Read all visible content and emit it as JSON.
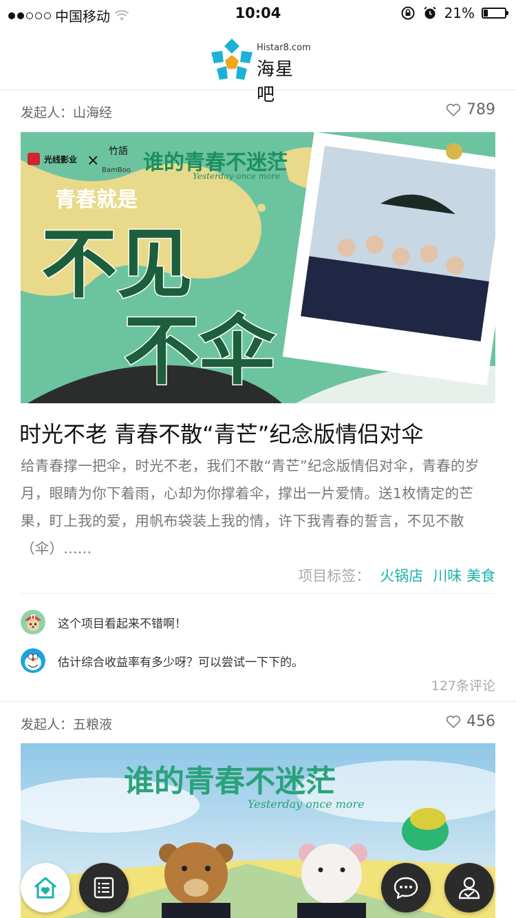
{
  "status_bar": {
    "carrier": "中国移动",
    "time": "10:04",
    "battery": "21%",
    "battery_level": 0.21
  },
  "header": {
    "logo_en": "Histar8.com",
    "logo_zh": "海星吧"
  },
  "cards": [
    {
      "initiator": "发起人：山海经",
      "likes": "789",
      "cover_text": {
        "title_art": "谁的青春不迷茫",
        "sub_art": "Yesterday once more",
        "slogan_small": "青春就是",
        "slogan_big_1": "不见",
        "slogan_big_2": "不伞",
        "brand_1": "光线影业",
        "brand_2": "竹語",
        "brand_2_sub": "BamBoo"
      },
      "title": "时光不老 青春不散“青芒”纪念版情侣对伞",
      "description": "给青春撑一把伞，时光不老，我们不散“青芒”纪念版情侣对伞，青春的岁月，眼睛为你下着雨，心却为你撑着伞，撑出一片爱情。送1枚情定的芒果，盯上我的爱，用帆布袋装上我的情，许下我青春的誓言，不见不散（伞）......",
      "tags_label": "项目标签：",
      "tags": [
        "火锅店",
        "川味 美食"
      ],
      "comments": [
        {
          "text": "这个项目看起来不错啊！",
          "avatar": "chopper-avatar"
        },
        {
          "text": "估计综合收益率有多少呀？可以尝试一下下的。",
          "avatar": "doraemon-avatar"
        }
      ],
      "comment_count": "127条评论"
    },
    {
      "initiator": "发起人：五粮液",
      "likes": "456",
      "cover_text": {
        "title_art": "谁的青春不迷茫",
        "sub_art": "Yesterday once more"
      }
    }
  ],
  "nav": {
    "home": "home-icon",
    "list": "list-icon",
    "chat": "chat-icon",
    "profile": "profile-icon"
  },
  "colors": {
    "accent": "#19b3a8",
    "cover_green": "#6cc3a0",
    "cover_yellow": "#e9d98a",
    "fab_dark": "#2b2b2b"
  }
}
